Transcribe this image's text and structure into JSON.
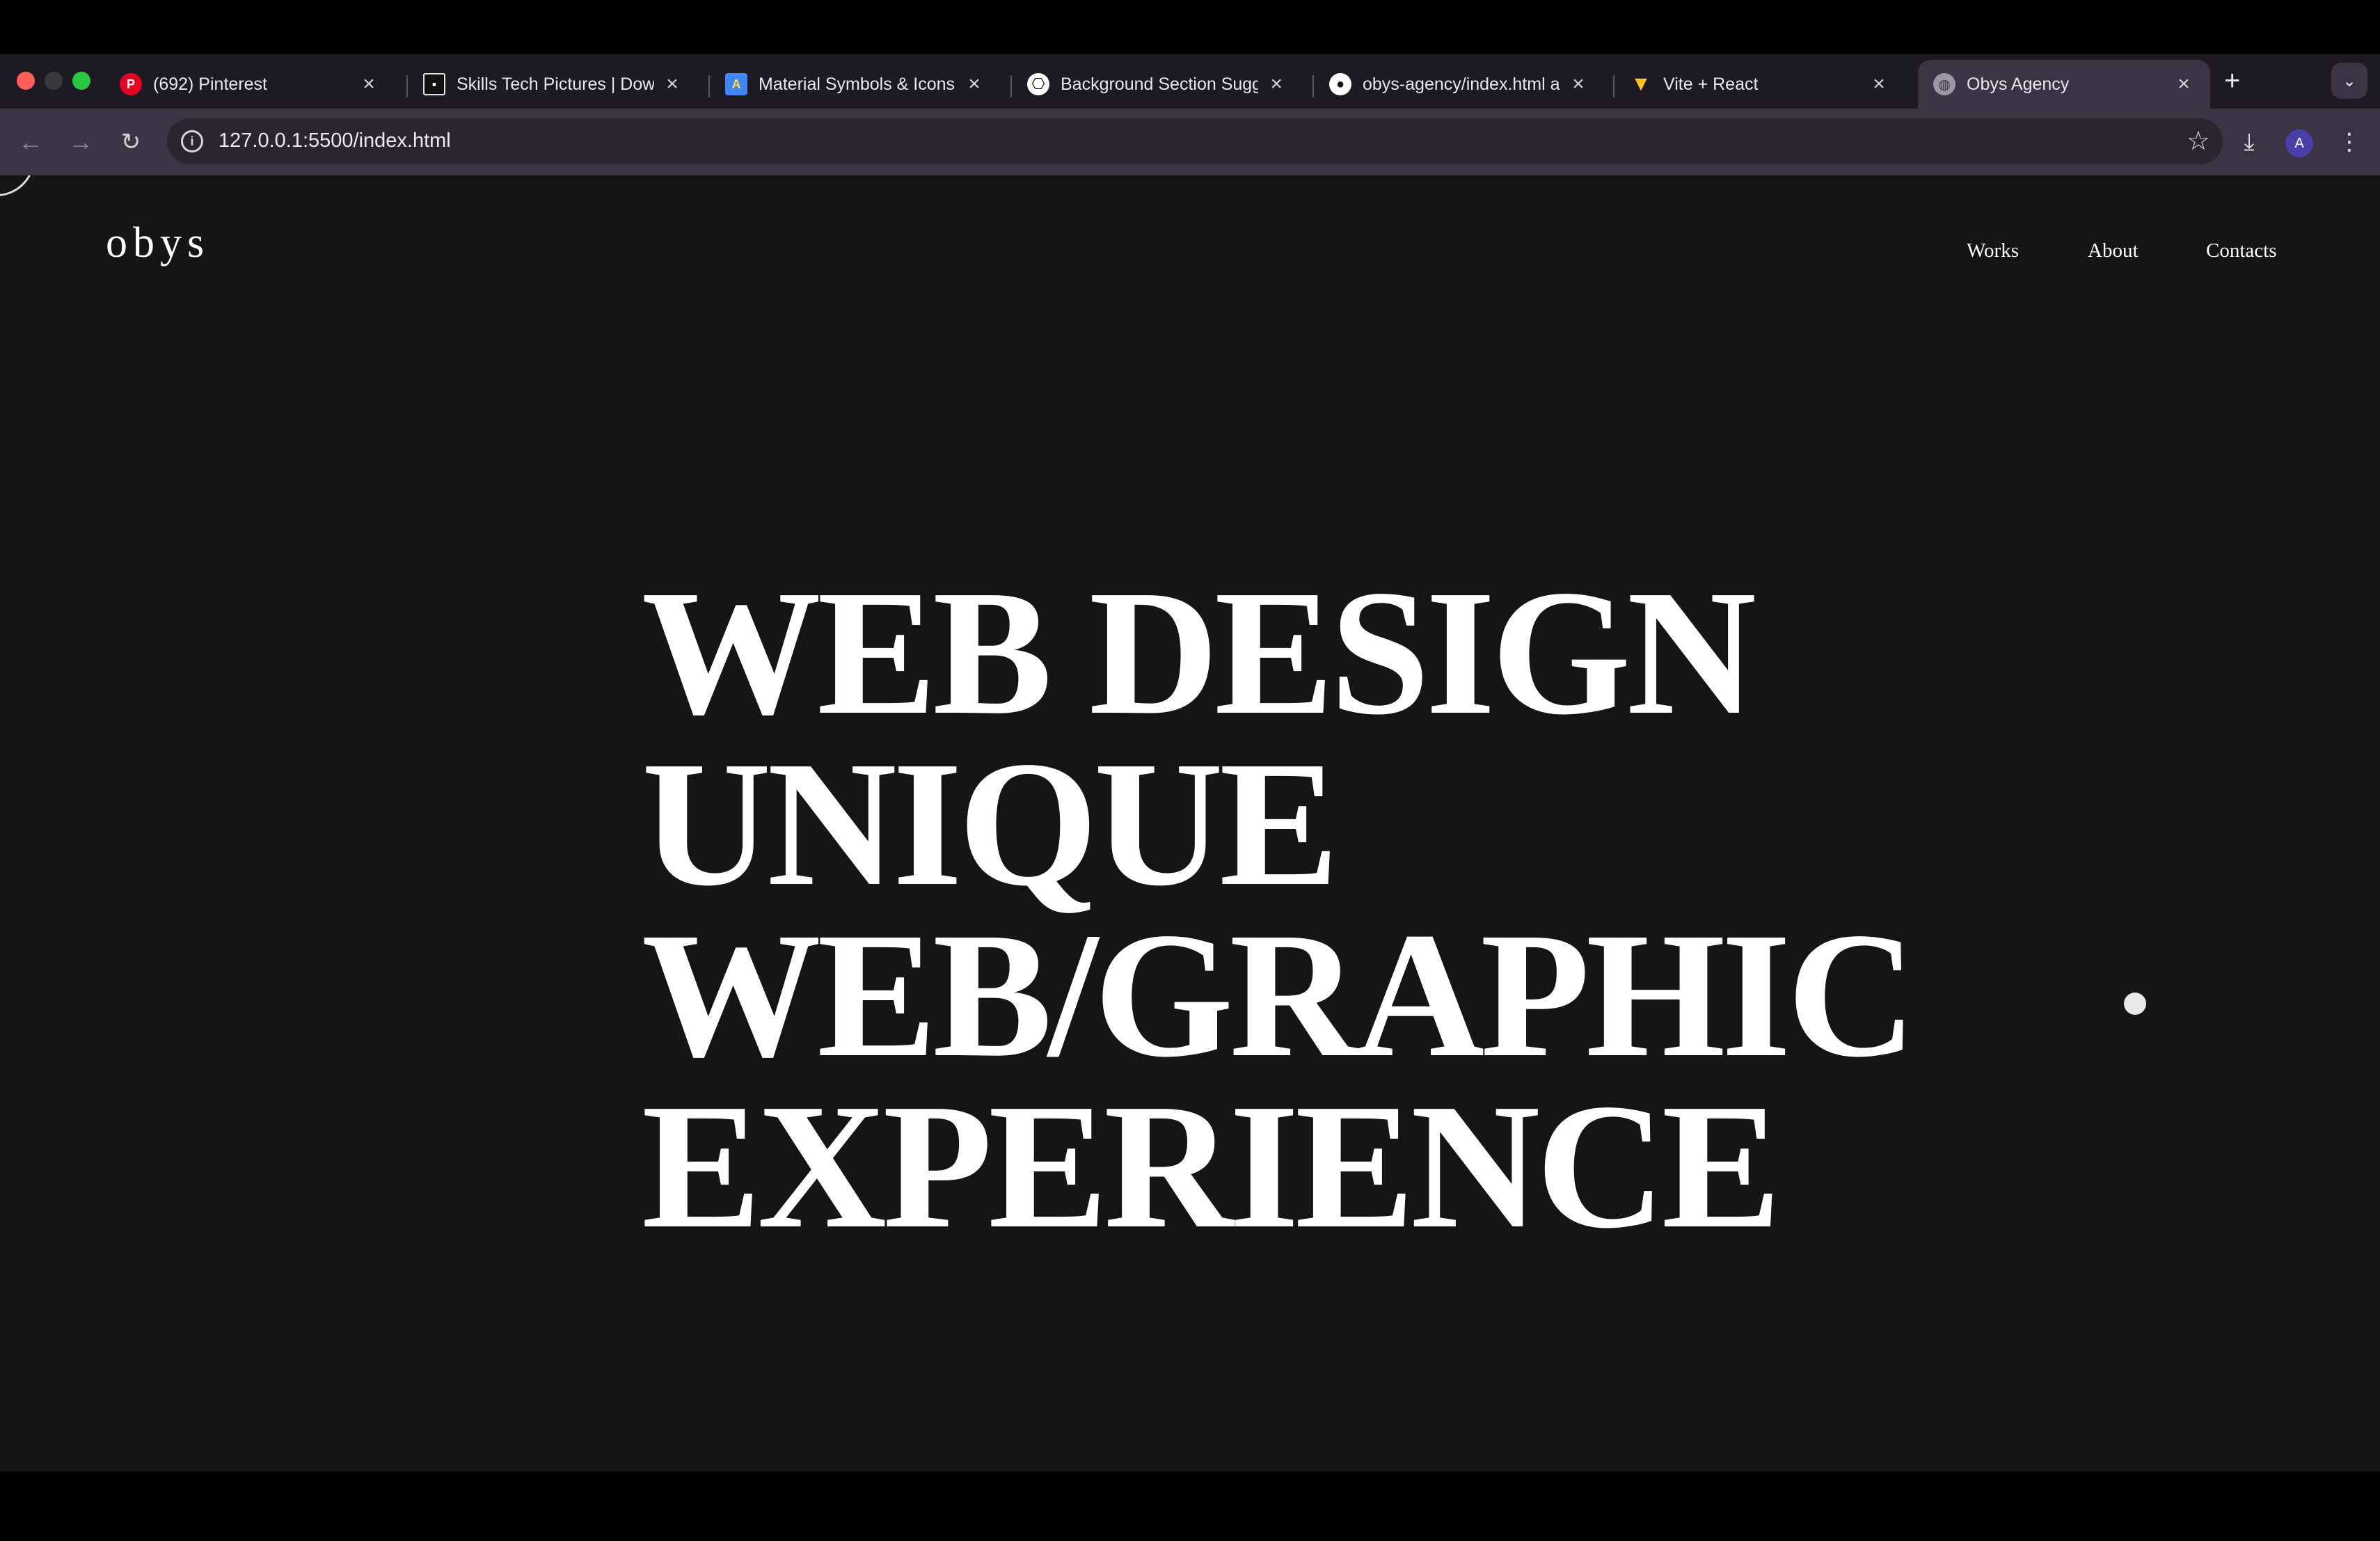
{
  "browser": {
    "tabs": [
      {
        "title": "(692) Pinterest",
        "icon": "pinterest-icon",
        "icon_color": "#e60023",
        "active": false
      },
      {
        "title": "Skills Tech Pictures | Dow",
        "icon": "unsplash-icon",
        "icon_color": "#111111",
        "active": false
      },
      {
        "title": "Material Symbols & Icons",
        "icon": "google-fonts-icon",
        "icon_color": "#4285f4",
        "active": false
      },
      {
        "title": "Background Section Sugg",
        "icon": "chatgpt-icon",
        "icon_color": "#ffffff",
        "active": false
      },
      {
        "title": "obys-agency/index.html a",
        "icon": "github-icon",
        "icon_color": "#ffffff",
        "active": false
      },
      {
        "title": "Vite + React",
        "icon": "vite-icon",
        "icon_color": "#a259ff",
        "active": false
      },
      {
        "title": "Obys Agency",
        "icon": "globe-icon",
        "icon_color": "#9c97a4",
        "active": true
      }
    ],
    "address": "127.0.0.1:5500/index.html",
    "profile_initial": "A"
  },
  "site": {
    "logo": "obys",
    "nav": [
      "Works",
      "About",
      "Contacts"
    ],
    "hero_lines": [
      "WEB DESIGN",
      "UNIQUE",
      "WEB/GRAPHIC",
      "EXPERIENCE"
    ]
  },
  "colors": {
    "page_background": "#151515",
    "text": "#ffffff",
    "chrome_background": "#1d1a24",
    "toolbar_background": "#3a3444"
  }
}
